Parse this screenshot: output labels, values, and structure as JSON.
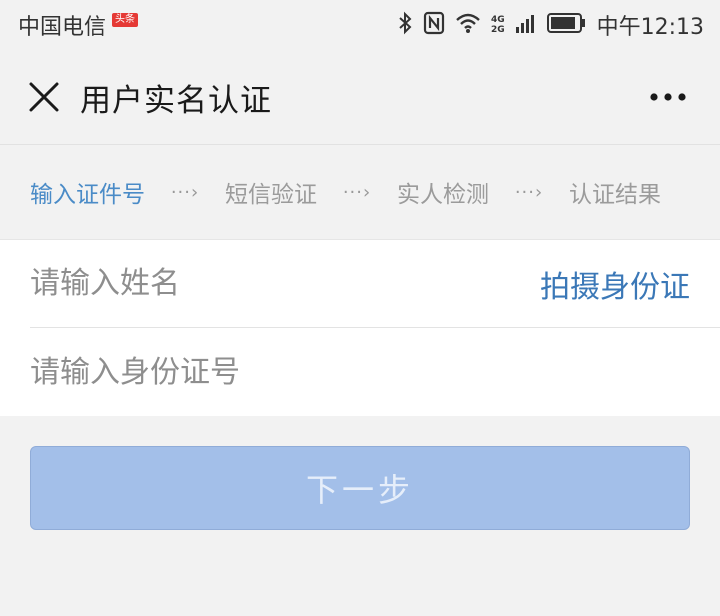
{
  "status_bar": {
    "carrier": "中国电信",
    "badge": "头条",
    "network_top": "4G",
    "network_bottom": "2G",
    "time": "中午12:13"
  },
  "header": {
    "title": "用户实名认证",
    "close_icon": "close-icon",
    "more_icon": "more-icon"
  },
  "steps": [
    {
      "label": "输入证件号",
      "active": true
    },
    {
      "label": "短信验证",
      "active": false
    },
    {
      "label": "实人检测",
      "active": false
    },
    {
      "label": "认证结果",
      "active": false
    }
  ],
  "step_separator": "···›",
  "form": {
    "name_placeholder": "请输入姓名",
    "scan_id_label": "拍摄身份证",
    "id_placeholder": "请输入身份证号"
  },
  "next_button": "下一步",
  "colors": {
    "active_step": "#4a8bc7",
    "link": "#3b78b7",
    "button_disabled": "#a3bfe9",
    "background": "#f2f2f2"
  }
}
